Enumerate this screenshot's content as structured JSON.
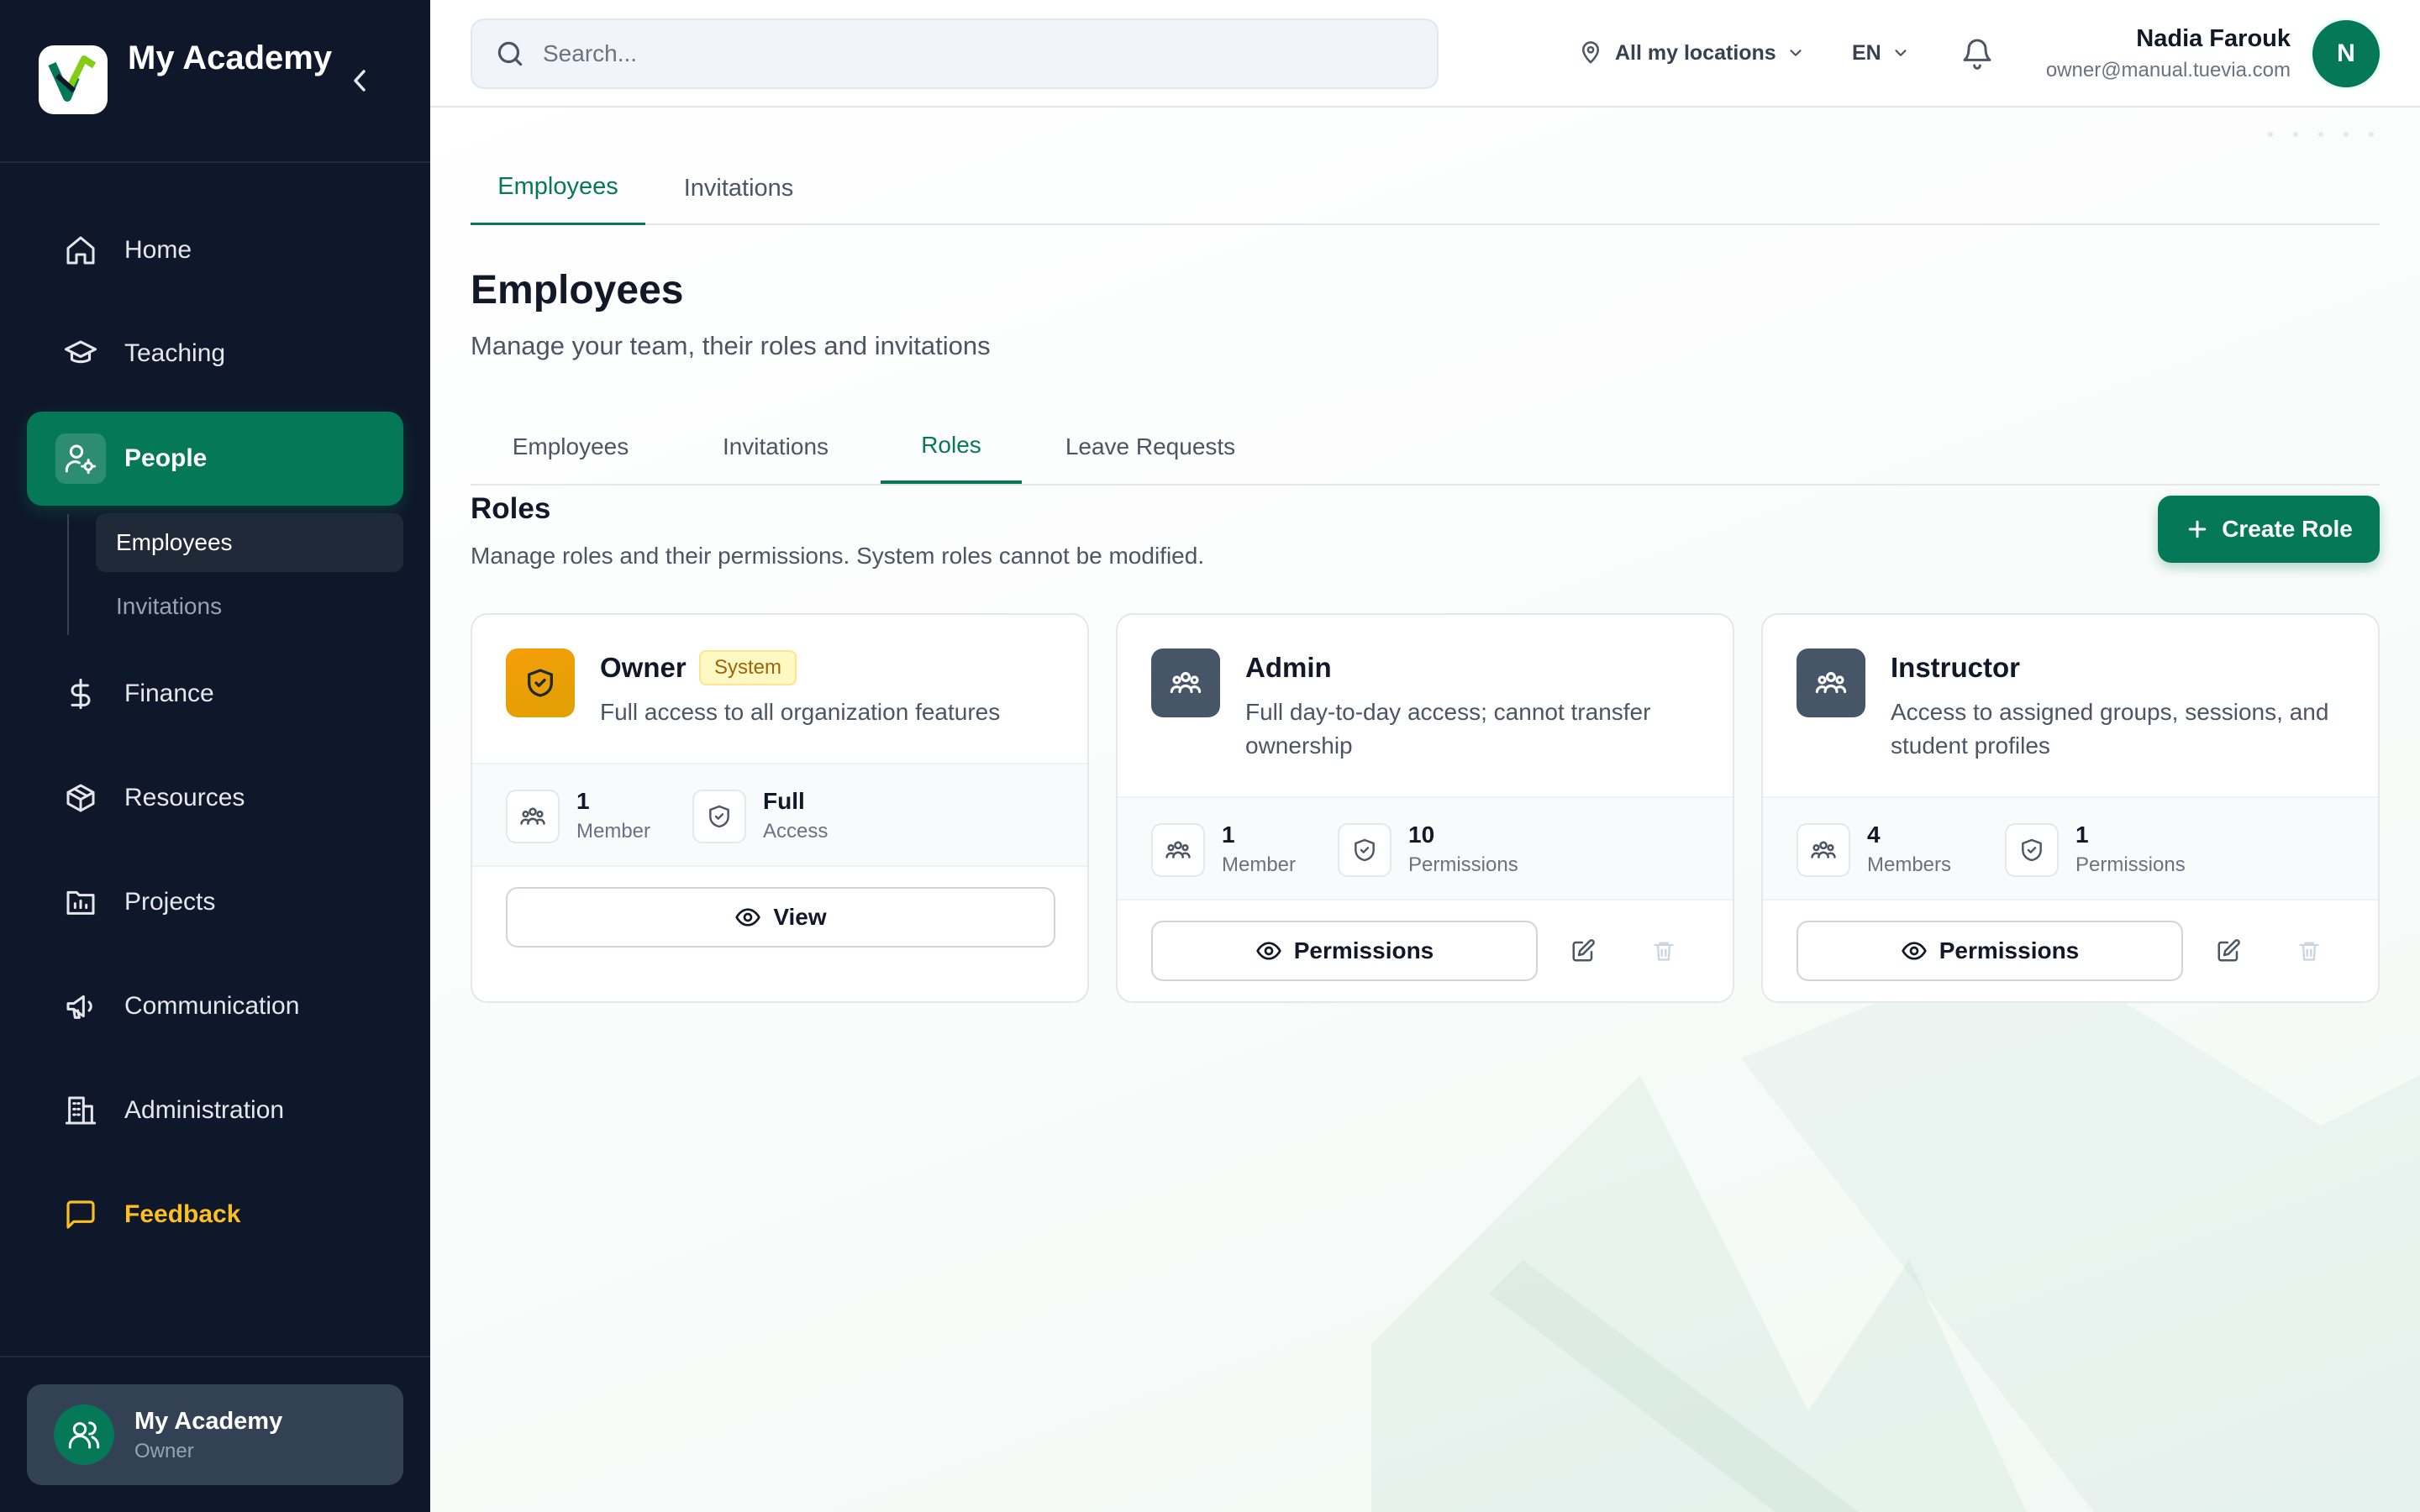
{
  "sidebar": {
    "brand": "My Academy",
    "nav": [
      {
        "label": "Home",
        "icon": "home-icon"
      },
      {
        "label": "Teaching",
        "icon": "graduation-cap-icon"
      },
      {
        "label": "People",
        "icon": "user-cog-icon"
      },
      {
        "label": "Finance",
        "icon": "dollar-icon"
      },
      {
        "label": "Resources",
        "icon": "box-icon"
      },
      {
        "label": "Projects",
        "icon": "chart-folder-icon"
      },
      {
        "label": "Communication",
        "icon": "megaphone-icon"
      },
      {
        "label": "Administration",
        "icon": "building-icon"
      },
      {
        "label": "Feedback",
        "icon": "message-square-icon"
      }
    ],
    "subnav": [
      {
        "label": "Employees"
      },
      {
        "label": "Invitations"
      }
    ],
    "account": {
      "name": "My Academy",
      "role": "Owner"
    }
  },
  "topbar": {
    "search_placeholder": "Search...",
    "location": "All my locations",
    "language": "EN",
    "user": {
      "name": "Nadia Farouk",
      "email": "owner@manual.tuevia.com",
      "initial": "N"
    }
  },
  "tabs_top": [
    {
      "label": "Employees",
      "active": true
    },
    {
      "label": "Invitations",
      "active": false
    }
  ],
  "page": {
    "title": "Employees",
    "subtitle": "Manage your team, their roles and invitations"
  },
  "tabs_sub": [
    {
      "label": "Employees",
      "active": false
    },
    {
      "label": "Invitations",
      "active": false
    },
    {
      "label": "Roles",
      "active": true
    },
    {
      "label": "Leave Requests",
      "active": false
    }
  ],
  "roles_section": {
    "title": "Roles",
    "subtitle": "Manage roles and their permissions. System roles cannot be modified.",
    "create_label": "Create Role"
  },
  "roles": [
    {
      "name": "Owner",
      "badge": "System",
      "description": "Full access to all organization features",
      "members_value": "1",
      "members_label": "Member",
      "perm_value": "Full",
      "perm_label": "Access",
      "action_label": "View",
      "accent": "#f59e0b"
    },
    {
      "name": "Admin",
      "description": "Full day-to-day access; cannot transfer ownership",
      "members_value": "1",
      "members_label": "Member",
      "perm_value": "10",
      "perm_label": "Permissions",
      "action_label": "Permissions",
      "accent": "#475569"
    },
    {
      "name": "Instructor",
      "description": "Access to assigned groups, sessions, and student profiles",
      "members_value": "4",
      "members_label": "Members",
      "perm_value": "1",
      "perm_label": "Permissions",
      "action_label": "Permissions",
      "accent": "#475569"
    }
  ],
  "colors": {
    "primary": "#047857",
    "sidebar_bg": "#0f172a",
    "feedback": "#fbbf24"
  }
}
